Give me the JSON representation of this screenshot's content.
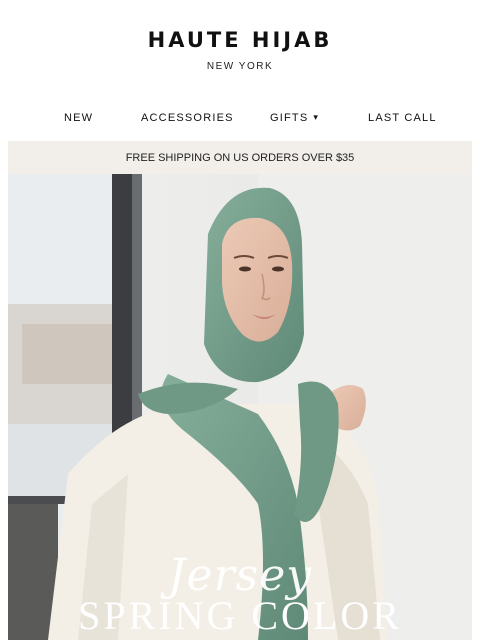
{
  "brand": {
    "name": "HAUTE HIJAB",
    "location": "NEW YORK"
  },
  "nav": {
    "items": [
      {
        "label": "NEW"
      },
      {
        "label": "ACCESSORIES"
      },
      {
        "label": "GIFTS",
        "icon": "chevron-down-icon"
      },
      {
        "label": "LAST CALL"
      }
    ]
  },
  "banner": {
    "text": "FREE SHIPPING ON US ORDERS OVER $35"
  },
  "hero": {
    "script_text": "Jersey",
    "headline": "SPRING COLOR",
    "colors": {
      "hijab": "#7aa390",
      "top": "#f3efe6",
      "wall": "#ececea"
    }
  }
}
